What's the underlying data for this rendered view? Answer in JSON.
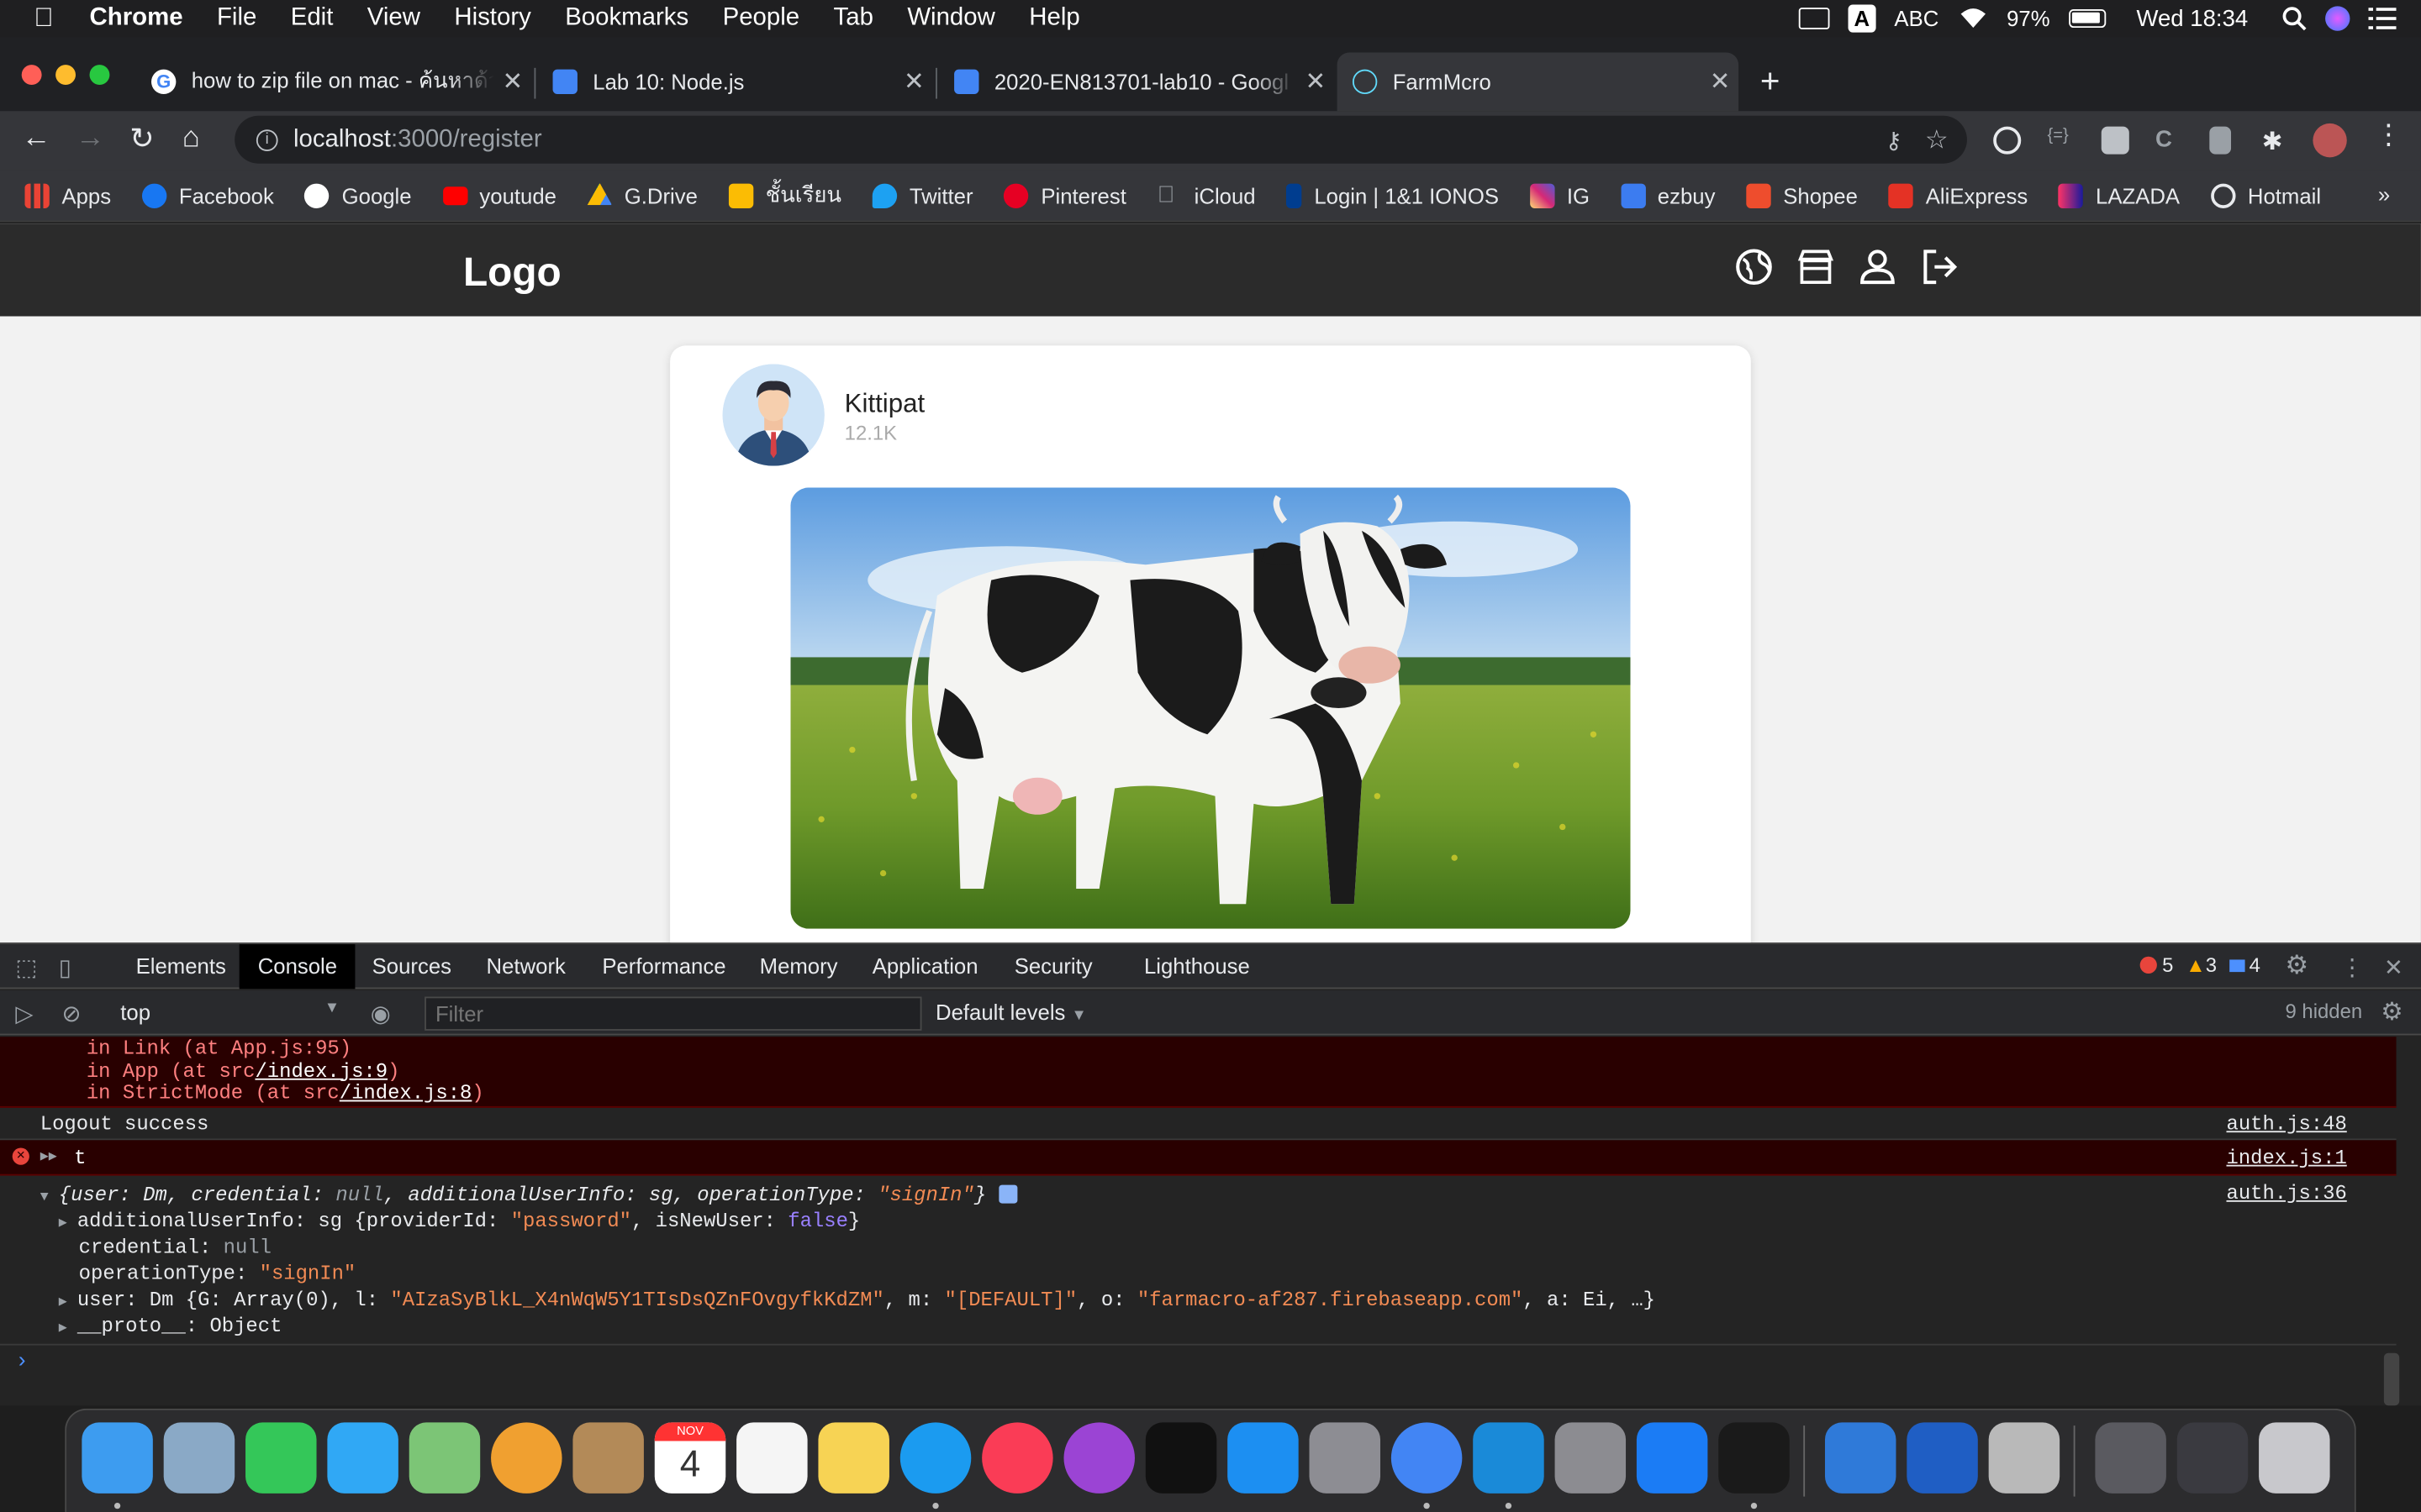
{
  "menubar": {
    "apple_icon": "apple-icon",
    "items": [
      "Chrome",
      "File",
      "Edit",
      "View",
      "History",
      "Bookmarks",
      "People",
      "Tab",
      "Window",
      "Help"
    ],
    "input_source": "ABC",
    "battery": "97%",
    "clock": "Wed 18:34"
  },
  "tabs": [
    {
      "title": "how to zip file on mac - ค้นหาด้วย",
      "favicon_color": "#ffffff"
    },
    {
      "title": "Lab 10: Node.js",
      "favicon_color": "#4285f4"
    },
    {
      "title": "2020-EN813701-lab10 - Googl",
      "favicon_color": "#4285f4"
    },
    {
      "title": "FarmMcro",
      "favicon_color": "#61dafb",
      "active": true
    }
  ],
  "address": {
    "host": "localhost",
    "path": ":3000/register"
  },
  "bookmarks": [
    {
      "label": "Apps",
      "color": "#ea4335"
    },
    {
      "label": "Facebook",
      "color": "#1877f2"
    },
    {
      "label": "Google",
      "color": "#ffffff"
    },
    {
      "label": "youtude",
      "color": "#ff0000"
    },
    {
      "label": "G.Drive",
      "color": "#fbbc04"
    },
    {
      "label": "ชั้นเรียน",
      "color": "#fbbc04"
    },
    {
      "label": "Twitter",
      "color": "#1da1f2"
    },
    {
      "label": "Pinterest",
      "color": "#e60023"
    },
    {
      "label": "iCloud",
      "color": "#9aa0a6"
    },
    {
      "label": "Login | 1&1 IONOS",
      "color": "#003d8f"
    },
    {
      "label": "IG",
      "color": "#c13584"
    },
    {
      "label": "ezbuy",
      "color": "#3c7cf0"
    },
    {
      "label": "Shopee",
      "color": "#ee4d2d"
    },
    {
      "label": "AliExpress",
      "color": "#e43225"
    },
    {
      "label": "LAZADA",
      "color": "#1a1a9c"
    },
    {
      "label": "Hotmail",
      "color": "#e8eaed"
    }
  ],
  "bookmarks_more": "»",
  "app": {
    "logo": "Logo",
    "nav_icons": [
      "globe-icon",
      "store-icon",
      "user-icon",
      "logout-icon"
    ],
    "post": {
      "username": "Kittipat",
      "count": "12.1K"
    }
  },
  "devtools": {
    "tabs": [
      "Elements",
      "Console",
      "Sources",
      "Network",
      "Performance",
      "Memory",
      "Application",
      "Security",
      "Lighthouse"
    ],
    "active_tab": "Console",
    "errors": "5",
    "warnings": "3",
    "infos": "4",
    "context": "top",
    "filter_placeholder": "Filter",
    "levels": "Default levels",
    "hidden": "9 hidden",
    "error_stack": [
      {
        "pre": "in Link (at App.js:95)",
        "link": "",
        "post": ""
      },
      {
        "pre": "in App (at src",
        "link": "/index.js:9",
        "post": ")"
      },
      {
        "pre": "in StrictMode (at src",
        "link": "/index.js:8",
        "post": ")"
      }
    ],
    "log1": {
      "text": "Logout success",
      "source": "auth.js:48"
    },
    "log2": {
      "text": "t",
      "source": "index.js:1"
    },
    "log3": {
      "source": "auth.js:36",
      "summary_prefix": "{user: Dm, credential: ",
      "summary_null": "null",
      "summary_mid": ", additionalUserInfo: sg, operationType: ",
      "summary_str": "\"signIn\"",
      "summary_end": "}",
      "additional_prefix": "additionalUserInfo: sg {providerId: ",
      "additional_str": "\"password\"",
      "additional_mid": ", isNewUser: ",
      "additional_bool": "false",
      "additional_end": "}",
      "credential_key": "credential: ",
      "credential_val": "null",
      "operation_key": "operationType: ",
      "operation_val": "\"signIn\"",
      "user_prefix": "user: Dm {G: Array(0), l: ",
      "user_l": "\"AIzaSyBlkL_X4nWqW5Y1TIsDsQZnFOvgyfkKdZM\"",
      "user_m_key": ", m: ",
      "user_m": "\"[DEFAULT]\"",
      "user_o_key": ", o: ",
      "user_o": "\"farmacro-af287.firebaseapp.com\"",
      "user_end": ", a: Ei, …}",
      "proto": "__proto__: Object"
    }
  },
  "dock": {
    "apps": [
      {
        "name": "finder",
        "color": "#3d9cf0"
      },
      {
        "name": "preview",
        "color": "#8aa9c6"
      },
      {
        "name": "facetime",
        "color": "#34c759"
      },
      {
        "name": "messages",
        "color": "#30a8f5"
      },
      {
        "name": "maps",
        "color": "#7cc576"
      },
      {
        "name": "photos",
        "color": "#f0a030"
      },
      {
        "name": "contacts",
        "color": "#b38a58"
      },
      {
        "name": "calendar",
        "color": "#ffffff"
      },
      {
        "name": "reminders",
        "color": "#f5f5f5"
      },
      {
        "name": "notes",
        "color": "#f7d354"
      },
      {
        "name": "safari",
        "color": "#1b9bf0"
      },
      {
        "name": "music",
        "color": "#fa3c56"
      },
      {
        "name": "podcasts",
        "color": "#9b44d4"
      },
      {
        "name": "tv",
        "color": "#111111"
      },
      {
        "name": "app-store",
        "color": "#1c8ff2"
      },
      {
        "name": "launchpad",
        "color": "#8d8d93"
      },
      {
        "name": "chrome",
        "color": "#4285f4"
      },
      {
        "name": "vscode",
        "color": "#1a8ad8"
      },
      {
        "name": "system-preferences",
        "color": "#8c8c91"
      },
      {
        "name": "xcode-tools",
        "color": "#1b7cf5"
      },
      {
        "name": "terminal",
        "color": "#1a1a1a"
      },
      {
        "name": "xcode",
        "color": "#2f7ad9"
      },
      {
        "name": "virtualbox",
        "color": "#1f5ec4"
      },
      {
        "name": "keychain",
        "color": "#b9b9b9"
      },
      {
        "name": "downloads-stack",
        "color": "#5a5a60"
      },
      {
        "name": "documents-stack",
        "color": "#3a3a40"
      },
      {
        "name": "trash",
        "color": "#c8c8cc"
      }
    ],
    "calendar_month": "NOV",
    "calendar_day": "4"
  }
}
